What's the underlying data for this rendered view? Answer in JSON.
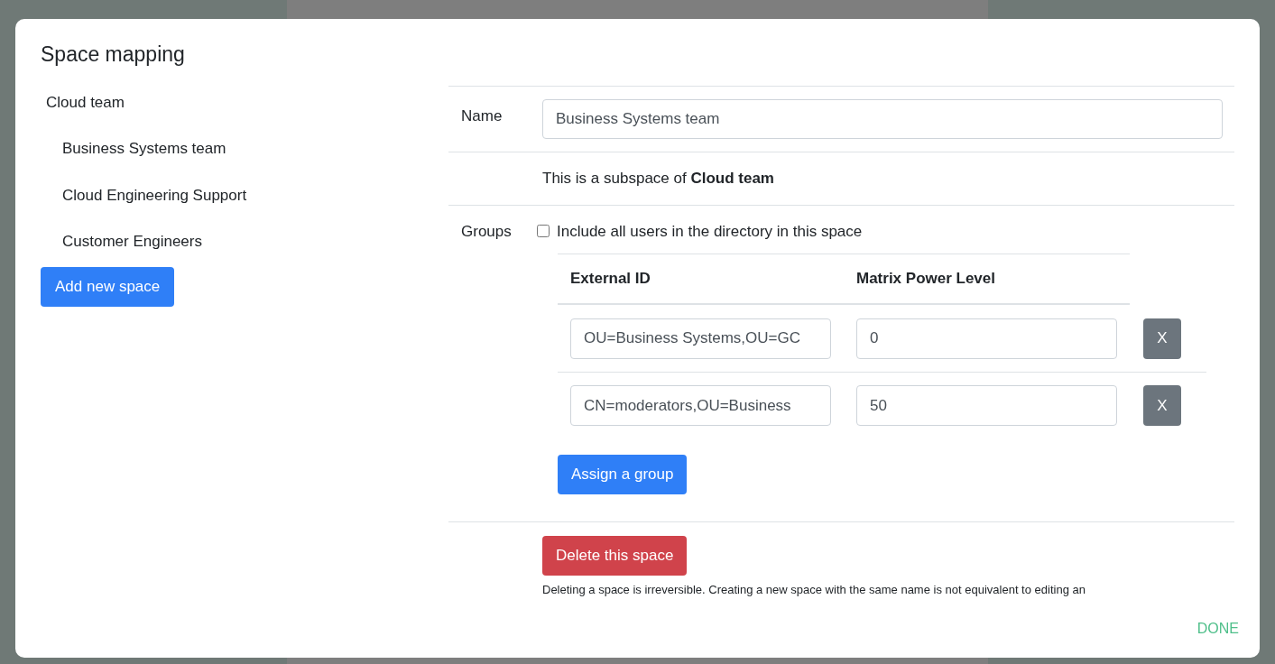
{
  "dialog": {
    "title": "Space mapping",
    "tree": [
      {
        "label": "Cloud team",
        "children": [
          {
            "label": "Business Systems team"
          },
          {
            "label": "Cloud Engineering Support"
          },
          {
            "label": "Customer Engineers"
          }
        ]
      }
    ],
    "add_button": "Add new space",
    "form": {
      "name_label": "Name",
      "name_value": "Business Systems team",
      "subspace_text": "This is a subspace of **Cloud team**",
      "groups_label": "Groups",
      "include_all": {
        "label": "Include all users in the directory in this space",
        "checked": false
      },
      "table": {
        "columns": [
          "External ID",
          "Matrix Power Level"
        ],
        "rows": [
          {
            "external_id": "OU=Business Systems,OU=GC",
            "power_level": "0",
            "remove": "X"
          },
          {
            "external_id": "CN=moderators,OU=Business",
            "power_level": "50",
            "remove": "X"
          }
        ]
      },
      "assign_button": "Assign a group",
      "delete_button": "Delete this space",
      "delete_note": "Deleting a space is irreversible. Creating a new space with the same name is not equivalent to editing an"
    },
    "done_button": "DONE"
  }
}
